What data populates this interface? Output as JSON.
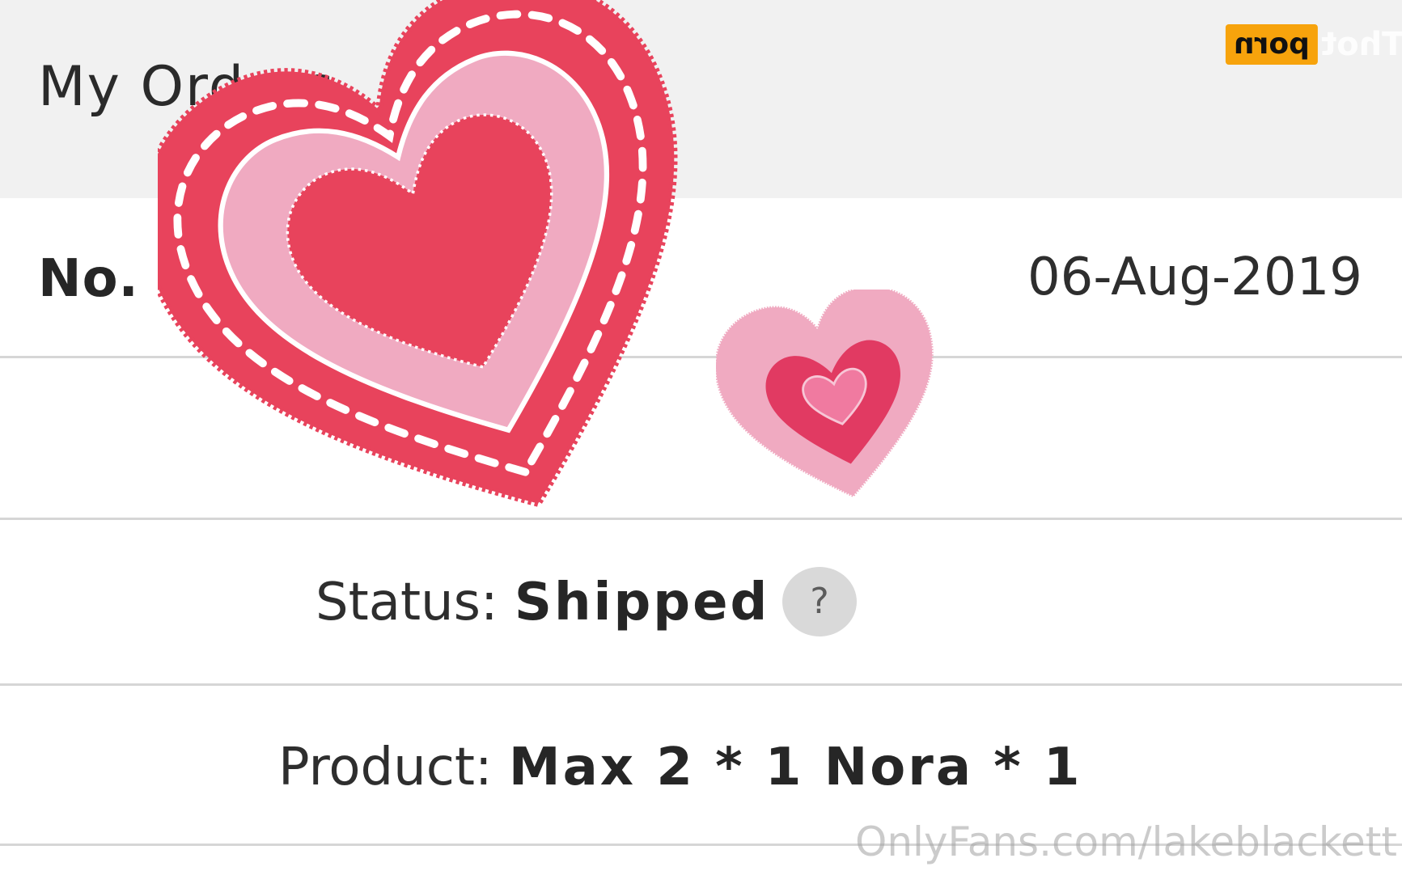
{
  "header": {
    "title": "My Orders"
  },
  "order": {
    "number_prefix": "No.",
    "date": "06-Aug-2019",
    "status_label": "Status:",
    "status_value": "Shipped",
    "help_symbol": "?",
    "product_label": "Product:",
    "product_value": "Max 2 * 1 Nora * 1"
  },
  "overlay": {
    "logo_badge": "porn",
    "logo_text": "Thot",
    "watermark": "OnlyFans.com/lakeblackett"
  },
  "colors": {
    "header_bg": "#f1f1f1",
    "heart_red": "#e8435c",
    "heart_pink": "#f0aac1",
    "logo_orange": "#f7a30c"
  },
  "icons": [
    "help-question-icon",
    "heart-sticker-icon",
    "small-heart-sticker-icon"
  ]
}
